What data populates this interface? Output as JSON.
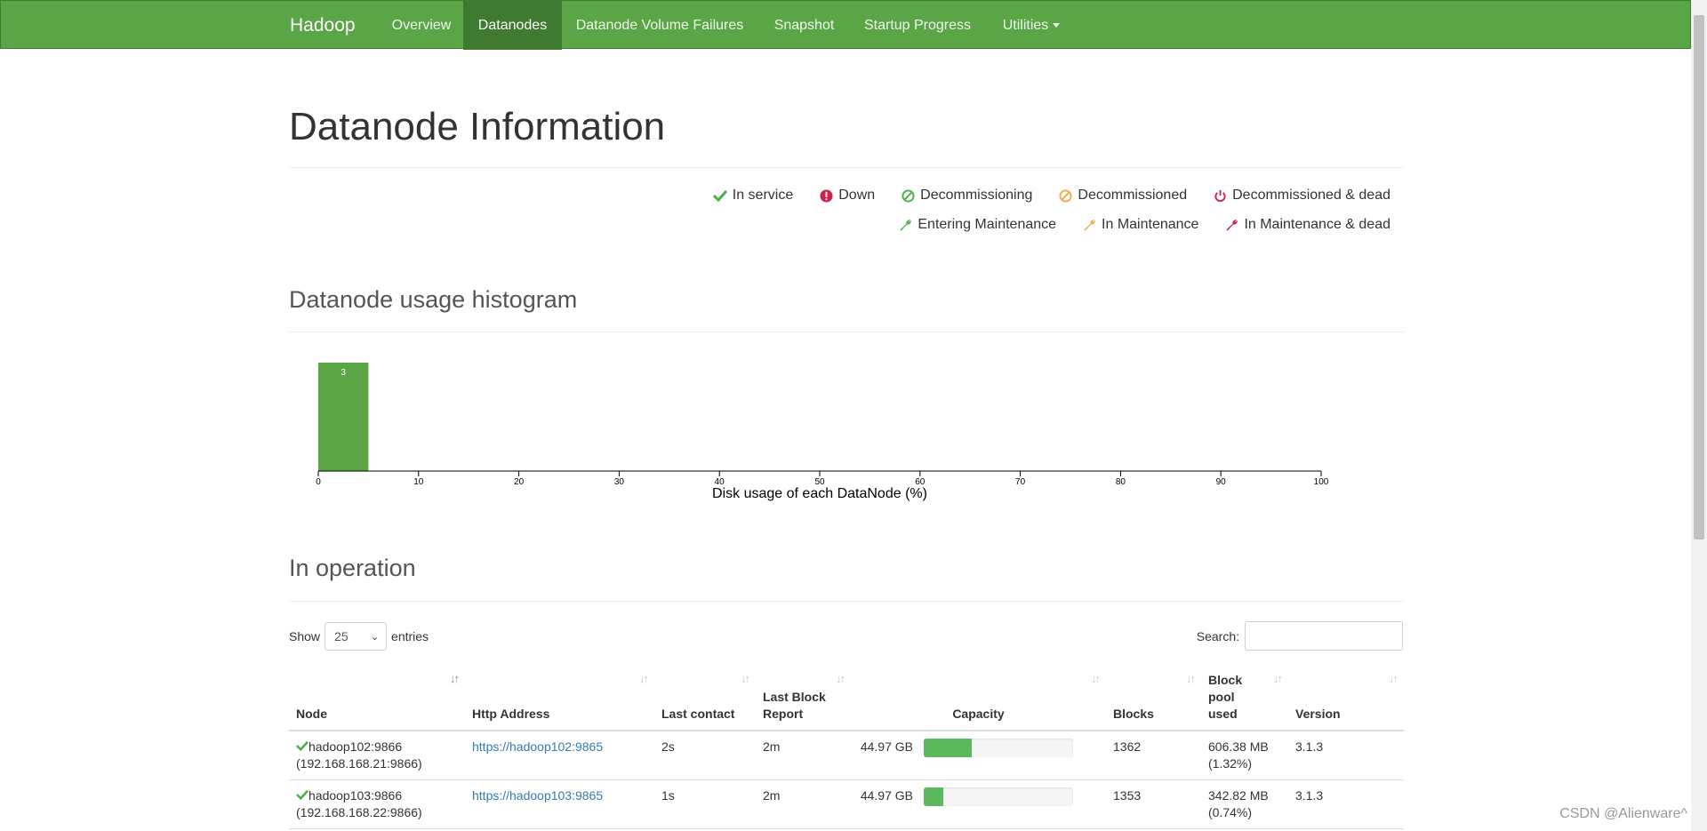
{
  "nav": {
    "brand": "Hadoop",
    "items": [
      {
        "label": "Overview",
        "active": false
      },
      {
        "label": "Datanodes",
        "active": true
      },
      {
        "label": "Datanode Volume Failures",
        "active": false
      },
      {
        "label": "Snapshot",
        "active": false
      },
      {
        "label": "Startup Progress",
        "active": false
      },
      {
        "label": "Utilities",
        "active": false
      }
    ]
  },
  "page_title": "Datanode Information",
  "legend": {
    "row1": [
      {
        "label": "In service",
        "icon": "check-icon",
        "color": "#4cae4c"
      },
      {
        "label": "Down",
        "icon": "exclamation-circle-icon",
        "color": "#c7254e"
      },
      {
        "label": "Decommissioning",
        "icon": "ban-icon",
        "color": "#4cae4c"
      },
      {
        "label": "Decommissioned",
        "icon": "ban-icon",
        "color": "#f0ad4e"
      },
      {
        "label": "Decommissioned & dead",
        "icon": "power-icon",
        "color": "#c7254e"
      }
    ],
    "row2": [
      {
        "label": "Entering Maintenance",
        "icon": "wrench-icon",
        "color": "#4cae4c"
      },
      {
        "label": "In Maintenance",
        "icon": "wrench-icon",
        "color": "#f0ad4e"
      },
      {
        "label": "In Maintenance & dead",
        "icon": "wrench-icon",
        "color": "#c7254e"
      }
    ]
  },
  "histogram": {
    "section_title": "Datanode usage histogram"
  },
  "chart_data": {
    "type": "bar",
    "xlabel": "Disk usage of each DataNode (%)",
    "xlim": [
      0,
      100
    ],
    "xticks": [
      0,
      10,
      20,
      30,
      40,
      50,
      60,
      70,
      80,
      90,
      100
    ],
    "bins": [
      {
        "x0": 0,
        "x1": 5,
        "count": 3
      }
    ],
    "bar_color": "#5aa545"
  },
  "operation": {
    "section_title": "In operation",
    "show_label": "Show",
    "entries_value": "25",
    "entries_label": "entries",
    "search_label": "Search:",
    "columns": [
      {
        "label": "Node"
      },
      {
        "label": "Http Address"
      },
      {
        "label": "Last contact"
      },
      {
        "label": "Last Block Report"
      },
      {
        "label": "Capacity"
      },
      {
        "label": "Blocks"
      },
      {
        "label": "Block pool used"
      },
      {
        "label": "Version"
      }
    ],
    "rows": [
      {
        "node_name": "hadoop102:9866",
        "node_ip": "(192.168.168.21:9866)",
        "http": "https://hadoop102:9865",
        "last_contact": "2s",
        "last_block_report": "2m",
        "capacity": "44.97 GB",
        "usage_fraction": 0.32,
        "blocks": "1362",
        "pool_used": "606.38 MB",
        "pool_pct": "(1.32%)",
        "version": "3.1.3"
      },
      {
        "node_name": "hadoop103:9866",
        "node_ip": "(192.168.168.22:9866)",
        "http": "https://hadoop103:9865",
        "last_contact": "1s",
        "last_block_report": "2m",
        "capacity": "44.97 GB",
        "usage_fraction": 0.13,
        "blocks": "1353",
        "pool_used": "342.82 MB",
        "pool_pct": "(0.74%)",
        "version": "3.1.3"
      }
    ]
  },
  "watermark": "CSDN @Alienware^"
}
